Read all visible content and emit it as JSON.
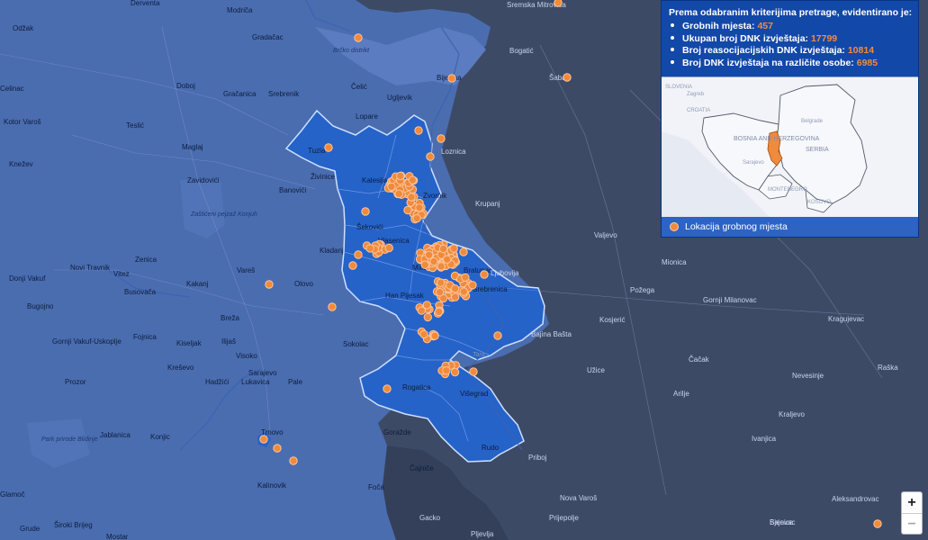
{
  "info": {
    "title": "Prema odabranim kriterijima pretrage, evidentirano je:",
    "stats": [
      {
        "label": "Grobnih mjesta:",
        "value": "457"
      },
      {
        "label": "Ukupan broj DNK izvještaja:",
        "value": "17799"
      },
      {
        "label": "Broj reasocijacijskih DNK izvještaja:",
        "value": "10814"
      },
      {
        "label": "Broj DNK izvještaja na različite osobe:",
        "value": "6985"
      }
    ]
  },
  "inset": {
    "labels": [
      "SLOVENIA",
      "Zagreb",
      "CROATIA",
      "BOSNIA AND HERZEGOVINA",
      "Sarajevo",
      "SERBIA",
      "Belgrade",
      "MONTENEGRO",
      "KOSOVO"
    ]
  },
  "legend": {
    "label": "Lokacija grobnog mjesta"
  },
  "zoom": {
    "in": "+",
    "out": "−"
  },
  "colors": {
    "highlight_region": "#2563c9",
    "marker": "#f08a3c",
    "map_light": "#4a6db0",
    "map_dark": "#3d4a66"
  },
  "map": {
    "places_light": [
      "Derventa",
      "Modriča",
      "Gradačac",
      "Brčko distrikt",
      "Odžak",
      "Celinac",
      "Doboj",
      "Gračanica",
      "Srebrenik",
      "Čelić",
      "Ugljevik",
      "Kotor Varoš",
      "Teslić",
      "Lopare",
      "Tuzla",
      "Maglaj",
      "Knežev",
      "Zavidovići",
      "Banovići",
      "Živinice",
      "Kalesija",
      "Zvornik",
      "Šekovići",
      "Vlasenica",
      "Kladanj",
      "Milići",
      "Bratunac",
      "Srebrenica",
      "Novi Travnik",
      "Vitez",
      "Kakanj",
      "Vareš",
      "Olovo",
      "Han Pijesak",
      "Zenica",
      "Donji Vakuf",
      "Busovača",
      "Bugojno",
      "Breža",
      "Fojnica",
      "Kiseljak",
      "Sokolac",
      "Gornji Vakuf-Uskoplje",
      "Kreševo",
      "Ilijaš",
      "Visoko",
      "Sarajevo",
      "Rogatica",
      "Višegrad",
      "Prozor",
      "Hadžići",
      "Pale",
      "Lukavica",
      "Jablanica",
      "Konjic",
      "Trnovo",
      "Goražde",
      "Rudo",
      "Čajniče",
      "Kalinovik",
      "Foča",
      "Glamoč",
      "Grude",
      "Široki Brijeg",
      "Mostar",
      "Bijeljina"
    ],
    "places_dark": [
      "Sremska Mitrovica",
      "Bogatić",
      "Šabac",
      "Loznica",
      "Krupanj",
      "Valjevo",
      "Ljubovija",
      "Bajina Bašta",
      "Mionica",
      "Kosjerić",
      "Užice",
      "Čačak",
      "Kraljevo",
      "Kragujevac",
      "Gornji Milanovac",
      "Požega",
      "Arilje",
      "Ivanjica",
      "Nova Varoš",
      "Priboj",
      "Prijepolje",
      "Sjenica",
      "Aleksandrovac",
      "Pljevlja",
      "Gacko",
      "Nevesinje",
      "Tara",
      "Bajevac",
      "Raška"
    ],
    "parks": [
      "Park prirode Blidinje",
      "Zaštićeni pejzaž Konjuh"
    ]
  }
}
